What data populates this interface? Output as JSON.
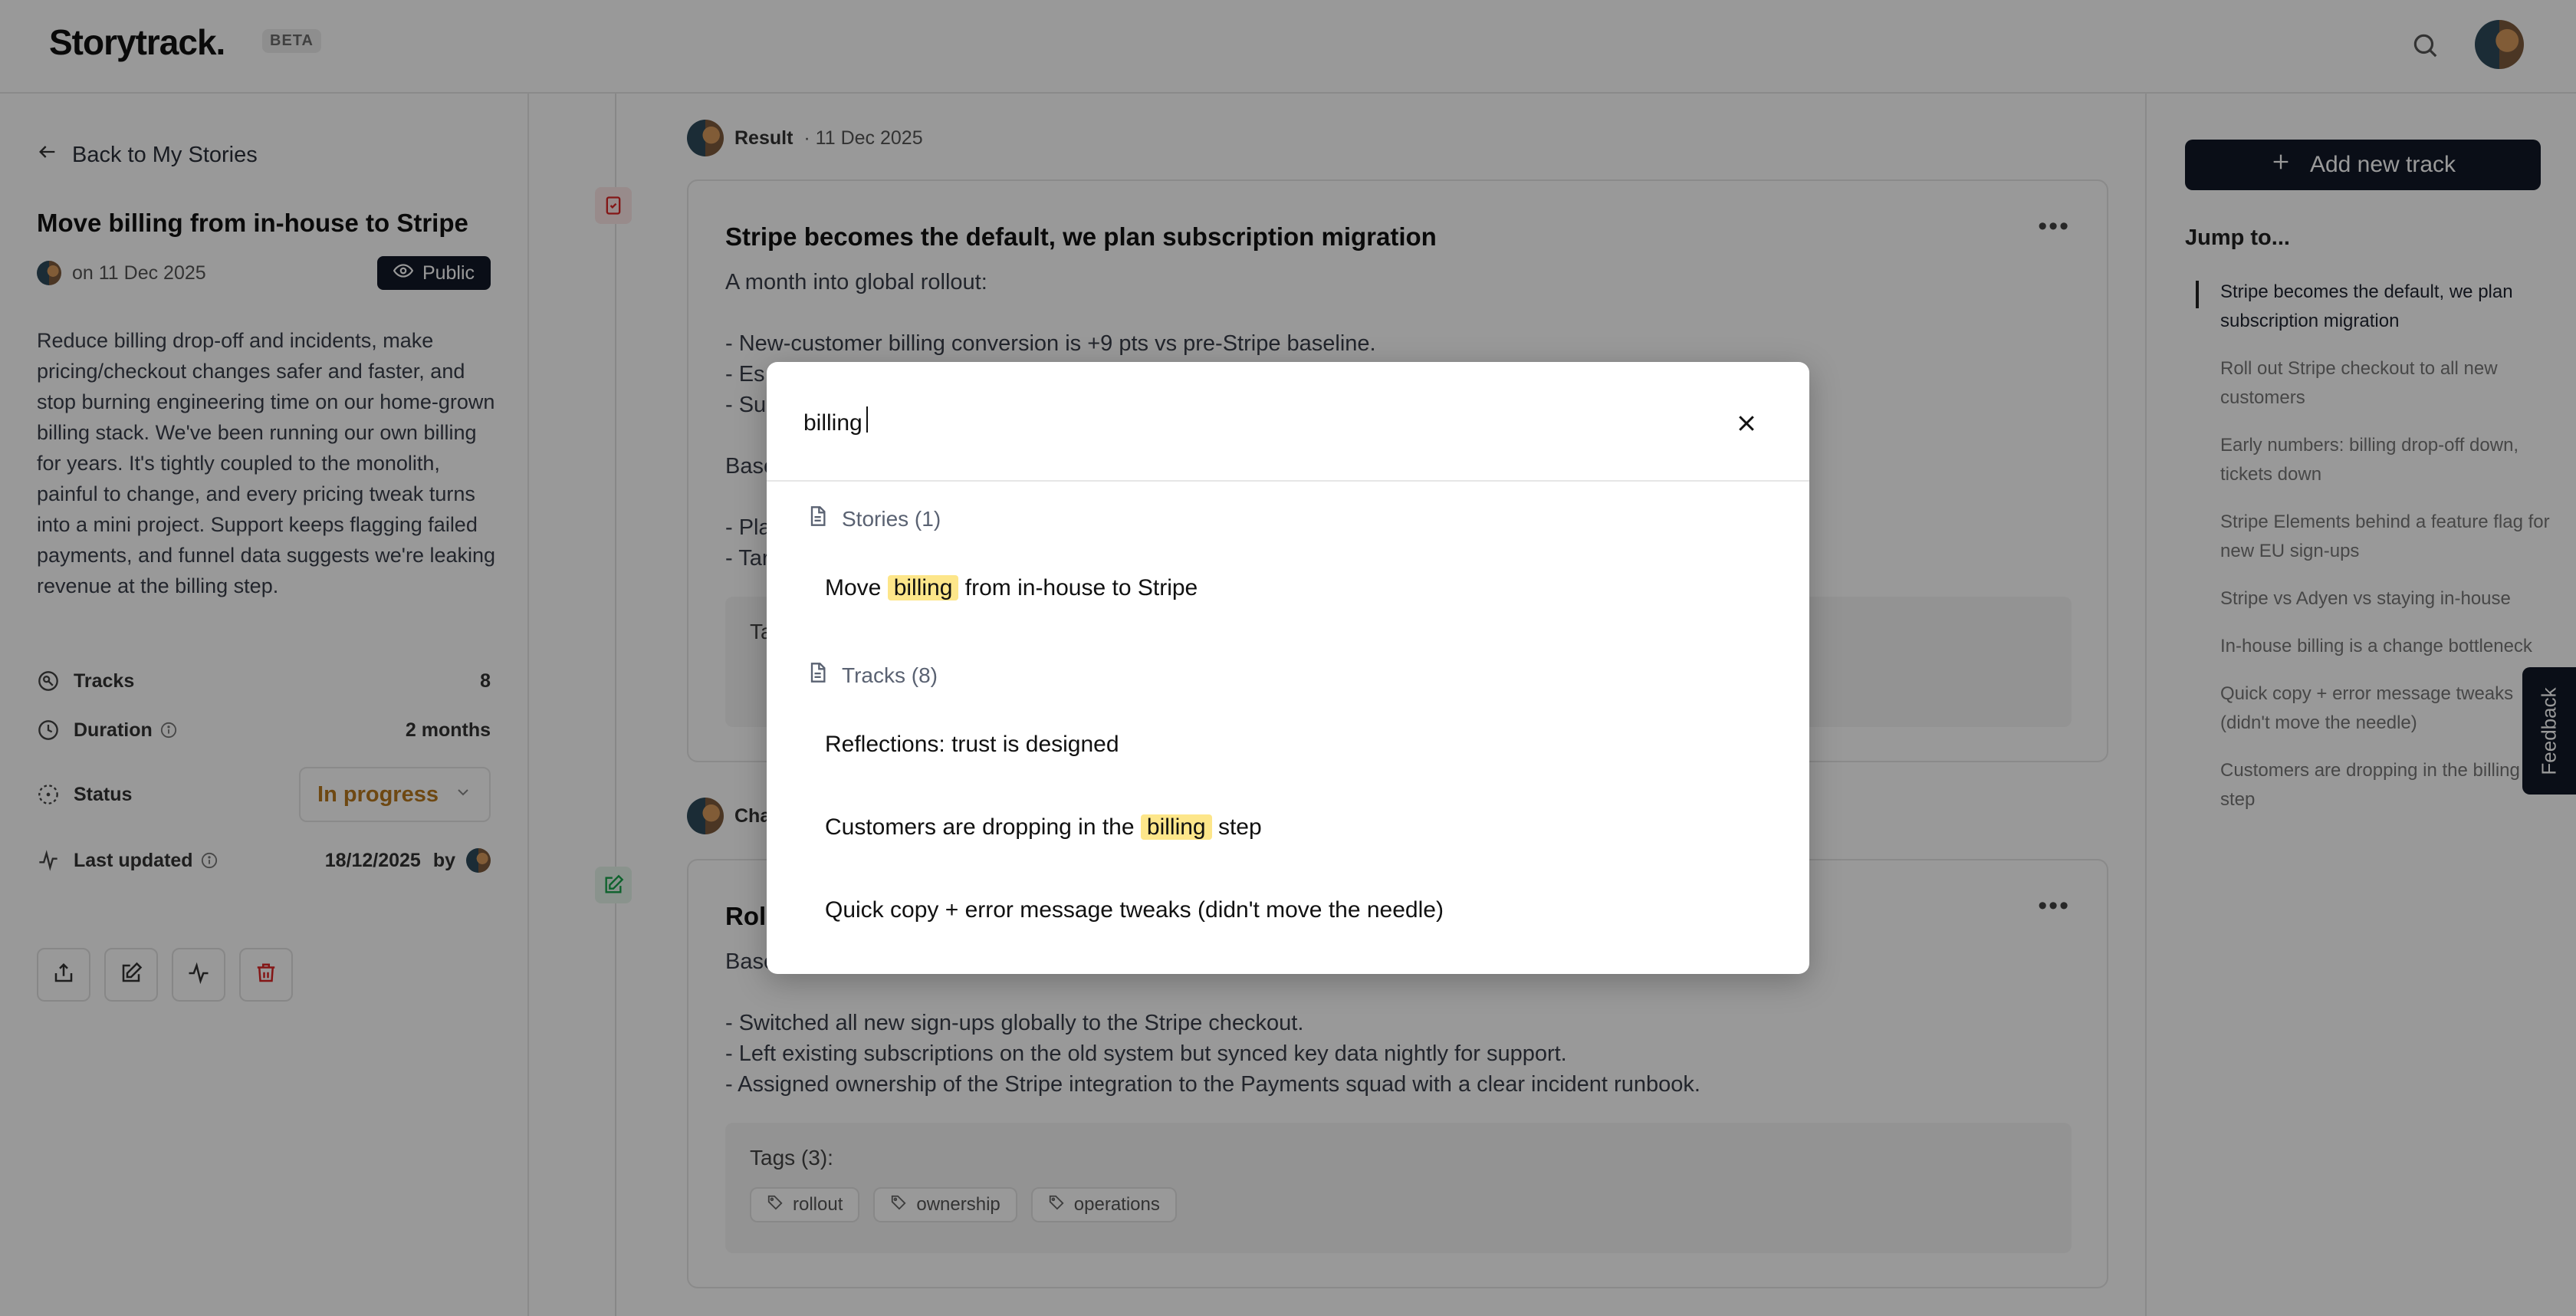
{
  "app": {
    "logo": "Storytrack.",
    "badge": "BETA"
  },
  "header": {
    "search_icon": "search-icon",
    "avatar": "user-avatar"
  },
  "story": {
    "back_label": "Back to My Stories",
    "title": "Move billing from in-house to Stripe",
    "date": "on 11 Dec 2025",
    "visibility": "Public",
    "description": "Reduce billing drop-off and incidents, make pricing/checkout changes safer and faster, and stop burning engineering time on our home-grown billing stack. We've been running our own billing for years. It's tightly coupled to the monolith, painful to change, and every pricing tweak turns into a mini project. Support keeps flagging failed payments, and funnel data suggests we're leaking revenue at the billing step.",
    "tracks_label": "Tracks",
    "tracks_value": "8",
    "duration_label": "Duration",
    "duration_value": "2 months",
    "status_label": "Status",
    "status_value": "In progress",
    "updated_label": "Last updated",
    "updated_value": "18/12/2025",
    "updated_by": "by"
  },
  "feed": [
    {
      "author_kind": "Result",
      "date": "· 11 Dec 2025",
      "title": "Stripe becomes the default, we plan subscription migration",
      "lines": [
        "A month into global rollout:",
        "",
        "- New-customer billing conversion is +9 pts vs pre-Stripe baseline.",
        "- Es",
        "- Su",
        "",
        "Base",
        "",
        "- Pla",
        "- Tar"
      ],
      "tags_peek": "Ta"
    },
    {
      "author_kind": "Cha",
      "title": "Roll",
      "lines": [
        "Base",
        "",
        "- Switched all new sign-ups globally to the Stripe checkout.",
        "- Left existing subscriptions on the old system but synced key data nightly for support.",
        "- Assigned ownership of the Stripe integration to the Payments squad with a clear incident runbook."
      ],
      "tags_label": "Tags (3):",
      "tags": [
        "rollout",
        "ownership",
        "operations"
      ]
    }
  ],
  "sidebar_right": {
    "add_track": "Add new track",
    "jump_title": "Jump to...",
    "items": [
      "Stripe becomes the default, we plan subscription migration",
      "Roll out Stripe checkout to all new customers",
      "Early numbers: billing drop-off down, tickets down",
      "Stripe Elements behind a feature flag for new EU sign-ups",
      "Stripe vs Adyen vs staying in-house",
      "In-house billing is a change bottleneck",
      "Quick copy + error message tweaks (didn't move the needle)",
      "Customers are dropping in the billing step"
    ],
    "feedback": "Feedback"
  },
  "search": {
    "query": "billing",
    "stories_heading": "Stories (1)",
    "story_result": {
      "before": "Move ",
      "match": "billing",
      "after": " from in-house to Stripe"
    },
    "tracks_heading": "Tracks (8)",
    "track_results": [
      {
        "before": "Reflections: trust is designed",
        "match": "",
        "after": ""
      },
      {
        "before": "Customers are dropping in the ",
        "match": "billing",
        "after": " step"
      },
      {
        "before": "Quick copy + error message tweaks (didn't move the needle)",
        "match": "",
        "after": ""
      }
    ]
  },
  "colors": {
    "primary": "#111827",
    "status": "#b7791f",
    "highlight": "#fde68a",
    "result_icon": "#dc2626",
    "change_icon": "#16a34a"
  }
}
